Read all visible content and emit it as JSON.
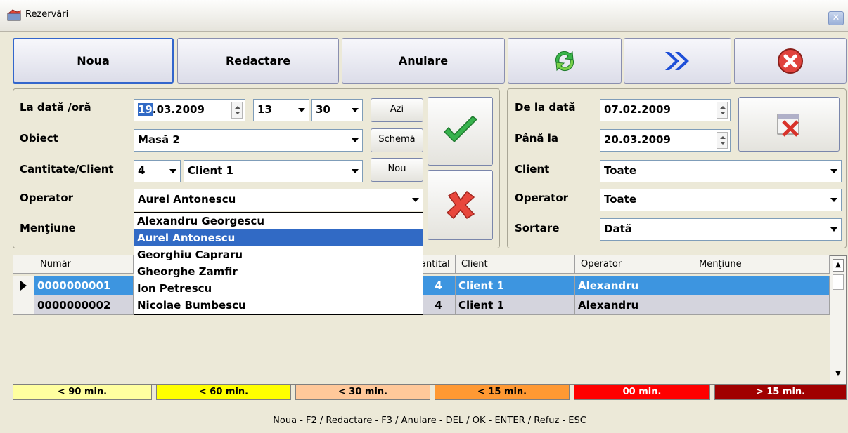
{
  "window": {
    "title": "Rezervări",
    "close_glyph": "✕"
  },
  "toolbar": {
    "new_label": "Noua",
    "edit_label": "Redactare",
    "cancel_label": "Anulare",
    "refresh_icon": "refresh-icon",
    "forward_icon": "fast-forward-icon",
    "close_icon": "close-circle-icon"
  },
  "form": {
    "date_label": "La dată /oră",
    "date_value": "19.03.2009",
    "date_selected_part": "19",
    "date_rest": ".03.2009",
    "hour_value": "13",
    "minute_value": "30",
    "today_label": "Azi",
    "object_label": "Obiect",
    "object_value": "Masă 2",
    "schema_label": "Schemă",
    "qty_client_label": "Cantitate/Client",
    "qty_value": "4",
    "client_value": "Client 1",
    "new_client_label": "Nou",
    "operator_label": "Operator",
    "operator_value": "Aurel Antonescu",
    "mention_label": "Menţiune"
  },
  "operator_options": [
    "Alexandru Georgescu",
    "Aurel Antonescu",
    "Georghiu Capraru",
    "Gheorghe Zamfir",
    "Ion Petrescu",
    "Nicolae Bumbescu"
  ],
  "operator_highlighted_index": 1,
  "filter": {
    "from_label": "De la dată",
    "from_value": "07.02.2009",
    "to_label": "Până la",
    "to_value": "20.03.2009",
    "client_label": "Client",
    "client_value": "Toate",
    "operator_label": "Operator",
    "operator_value": "Toate",
    "sort_label": "Sortare",
    "sort_value": "Dată"
  },
  "table": {
    "columns": [
      "Număr",
      "Cantitate",
      "Client",
      "Operator",
      "Menţiune"
    ],
    "column_qty_visible": "antital",
    "rows": [
      {
        "number": "0000000001",
        "qty": "4",
        "client": "Client 1",
        "operator": "Alexandru",
        "mention": ""
      },
      {
        "number": "0000000002",
        "qty": "4",
        "client": "Client 1",
        "operator": "Alexandru",
        "mention": ""
      }
    ]
  },
  "legend": [
    {
      "label": "< 90 min.",
      "color": "#ffffa0"
    },
    {
      "label": "< 60 min.",
      "color": "#ffff00"
    },
    {
      "label": "< 30 min.",
      "color": "#ffc89a"
    },
    {
      "label": "< 15 min.",
      "color": "#ff9933"
    },
    {
      "label": "00 min.",
      "color": "#ff0000"
    },
    {
      "label": "> 15 min.",
      "color": "#a00000"
    }
  ],
  "status": "Noua - F2 / Redactare - F3 / Anulare - DEL /  OK - ENTER / Refuz - ESC"
}
